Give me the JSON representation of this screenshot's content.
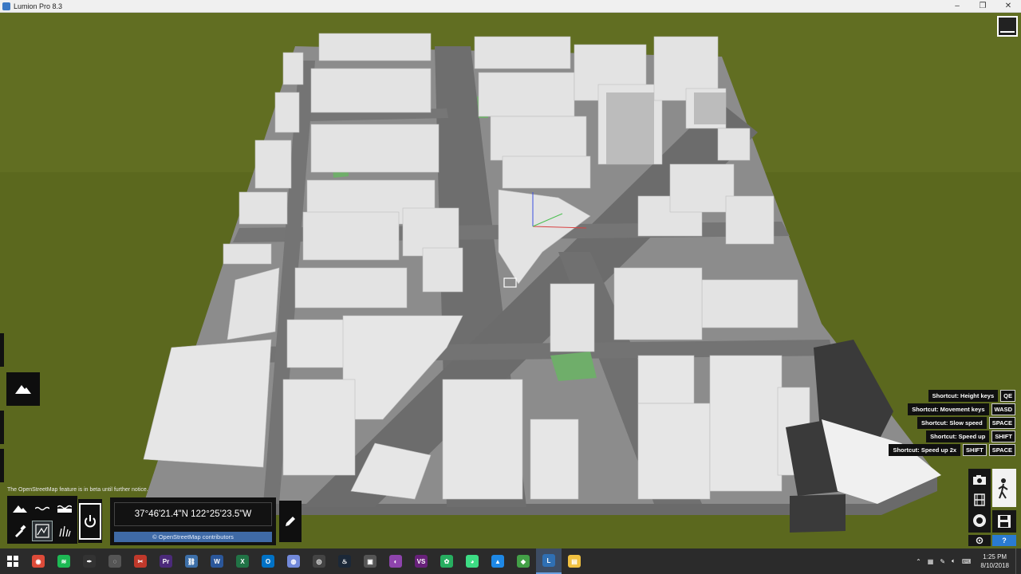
{
  "window": {
    "title": "Lumion Pro 8.3",
    "min_glyph": "–",
    "max_glyph": "❐",
    "close_glyph": "✕"
  },
  "status": {
    "beta_note": "The OpenStreetMap feature is in beta until further notice."
  },
  "location": {
    "coordinates": "37°46'21.4\"N 122°25'23.5\"W",
    "attribution": "© OpenStreetMap contributors"
  },
  "shortcuts": [
    {
      "label": "Shortcut: Height keys",
      "keys": [
        "QE"
      ]
    },
    {
      "label": "Shortcut: Movement keys",
      "keys": [
        "WASD"
      ]
    },
    {
      "label": "Shortcut: Slow speed",
      "keys": [
        "SPACE"
      ]
    },
    {
      "label": "Shortcut: Speed up",
      "keys": [
        "SHIFT"
      ]
    },
    {
      "label": "Shortcut: Speed up 2x",
      "keys": [
        "SHIFT",
        "SPACE"
      ]
    }
  ],
  "help_label": "?",
  "colors": {
    "grass": "#5d6a1f",
    "ground": "#8a8a8a",
    "road": "#6e6e6e",
    "building": "#e6e6e6",
    "park": "#6fae6a",
    "osm_bar": "#3f6aa6"
  },
  "taskbar": {
    "clock_time": "1:25 PM",
    "clock_date": "8/10/2018",
    "apps": [
      {
        "name": "chrome",
        "color": "#dd4b39",
        "glyph": "◉"
      },
      {
        "name": "spotify",
        "color": "#1db954",
        "glyph": "≋"
      },
      {
        "name": "inkscape",
        "color": "#333333",
        "glyph": "✒"
      },
      {
        "name": "blender",
        "color": "#555555",
        "glyph": "◌"
      },
      {
        "name": "tool",
        "color": "#c0392b",
        "glyph": "✂"
      },
      {
        "name": "premiere",
        "color": "#4b2a7a",
        "glyph": "Pr"
      },
      {
        "name": "link",
        "color": "#3d6fa8",
        "glyph": "⛓"
      },
      {
        "name": "word",
        "color": "#2b579a",
        "glyph": "W"
      },
      {
        "name": "excel",
        "color": "#217346",
        "glyph": "X"
      },
      {
        "name": "outlook",
        "color": "#0072c6",
        "glyph": "O"
      },
      {
        "name": "discord",
        "color": "#7289da",
        "glyph": "◍"
      },
      {
        "name": "overwatch",
        "color": "#444444",
        "glyph": "◎"
      },
      {
        "name": "steam",
        "color": "#1b2838",
        "glyph": "♨"
      },
      {
        "name": "game",
        "color": "#555555",
        "glyph": "▣"
      },
      {
        "name": "purple-app",
        "color": "#8e44ad",
        "glyph": "◐"
      },
      {
        "name": "visual-studio",
        "color": "#68217a",
        "glyph": "VS"
      },
      {
        "name": "green-app",
        "color": "#27ae60",
        "glyph": "✿"
      },
      {
        "name": "android",
        "color": "#3ddc84",
        "glyph": "◕"
      },
      {
        "name": "blue-app",
        "color": "#1e88e5",
        "glyph": "▲"
      },
      {
        "name": "green-tool",
        "color": "#43a047",
        "glyph": "◆"
      },
      {
        "name": "lumion",
        "color": "#2f6fb3",
        "glyph": "L"
      },
      {
        "name": "explorer",
        "color": "#f0c040",
        "glyph": "▤"
      }
    ]
  }
}
